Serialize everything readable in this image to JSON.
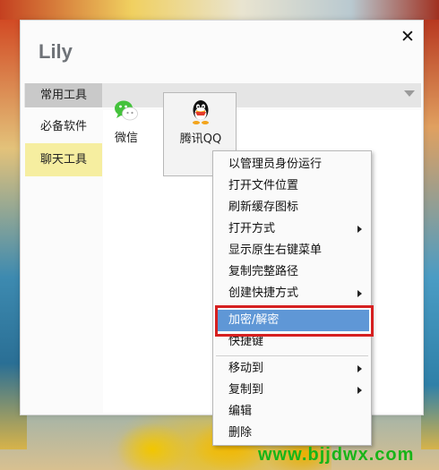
{
  "window": {
    "title": "Lily",
    "close_glyph": "✕"
  },
  "sidebar": {
    "tabs": [
      {
        "label": "常用工具"
      },
      {
        "label": "必备软件"
      },
      {
        "label": "聊天工具"
      }
    ]
  },
  "apps": [
    {
      "label": "微信",
      "icon": "wechat-icon"
    },
    {
      "label": "腾讯QQ",
      "icon": "qq-icon"
    }
  ],
  "context_menu": {
    "items": [
      {
        "label": "以管理员身份运行"
      },
      {
        "label": "打开文件位置"
      },
      {
        "label": "刷新缓存图标"
      },
      {
        "label": "打开方式",
        "submenu": true
      },
      {
        "label": "显示原生右键菜单"
      },
      {
        "label": "复制完整路径"
      },
      {
        "label": "创建快捷方式",
        "submenu": true
      },
      {
        "label": "加密/解密",
        "highlighted": true
      },
      {
        "label": "快捷键"
      },
      {
        "label": "移动到",
        "submenu": true
      },
      {
        "label": "复制到",
        "submenu": true
      },
      {
        "label": "编辑"
      },
      {
        "label": "删除"
      }
    ]
  },
  "watermark": "www.bjjdwx.com",
  "colors": {
    "highlight_bg": "#5f97d6",
    "annotation_box": "#d62020",
    "selected_tab": "#f6eea0",
    "watermark": "#18b418"
  }
}
